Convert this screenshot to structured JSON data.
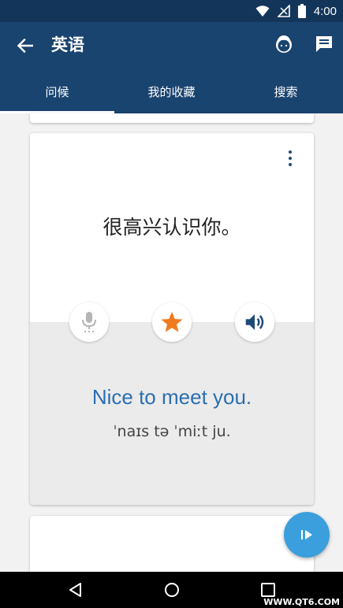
{
  "status_bar": {
    "time": "4:00",
    "icons": [
      "wifi-icon",
      "signal-icon",
      "battery-icon"
    ]
  },
  "app_bar": {
    "title": "英语",
    "icons": [
      "back-arrow-icon",
      "avatar-icon",
      "chat-icon"
    ],
    "tabs": [
      {
        "label": "问候",
        "active": true
      },
      {
        "label": "我的收藏",
        "active": false
      },
      {
        "label": "搜索",
        "active": false
      }
    ]
  },
  "card": {
    "phrase": "很高兴认识你。",
    "translation": "Nice to meet you.",
    "pronunciation": "ˈnaɪs tə ˈmiːt ju.",
    "buttons": [
      "mic-icon",
      "star-icon",
      "speaker-icon"
    ],
    "menu_icon": "more-vert-icon"
  },
  "fab": {
    "icon": "play-icon"
  },
  "nav_bar": {
    "icons": [
      "nav-back-icon",
      "nav-home-icon",
      "nav-recents-icon"
    ],
    "watermark": "WWW.QT6.COM"
  },
  "colors": {
    "app_bar": "#1a4470",
    "status_bar": "#13355a",
    "accent_star": "#f07a1e",
    "translation_text": "#2a6fb0",
    "fab": "#3a9fdc"
  }
}
